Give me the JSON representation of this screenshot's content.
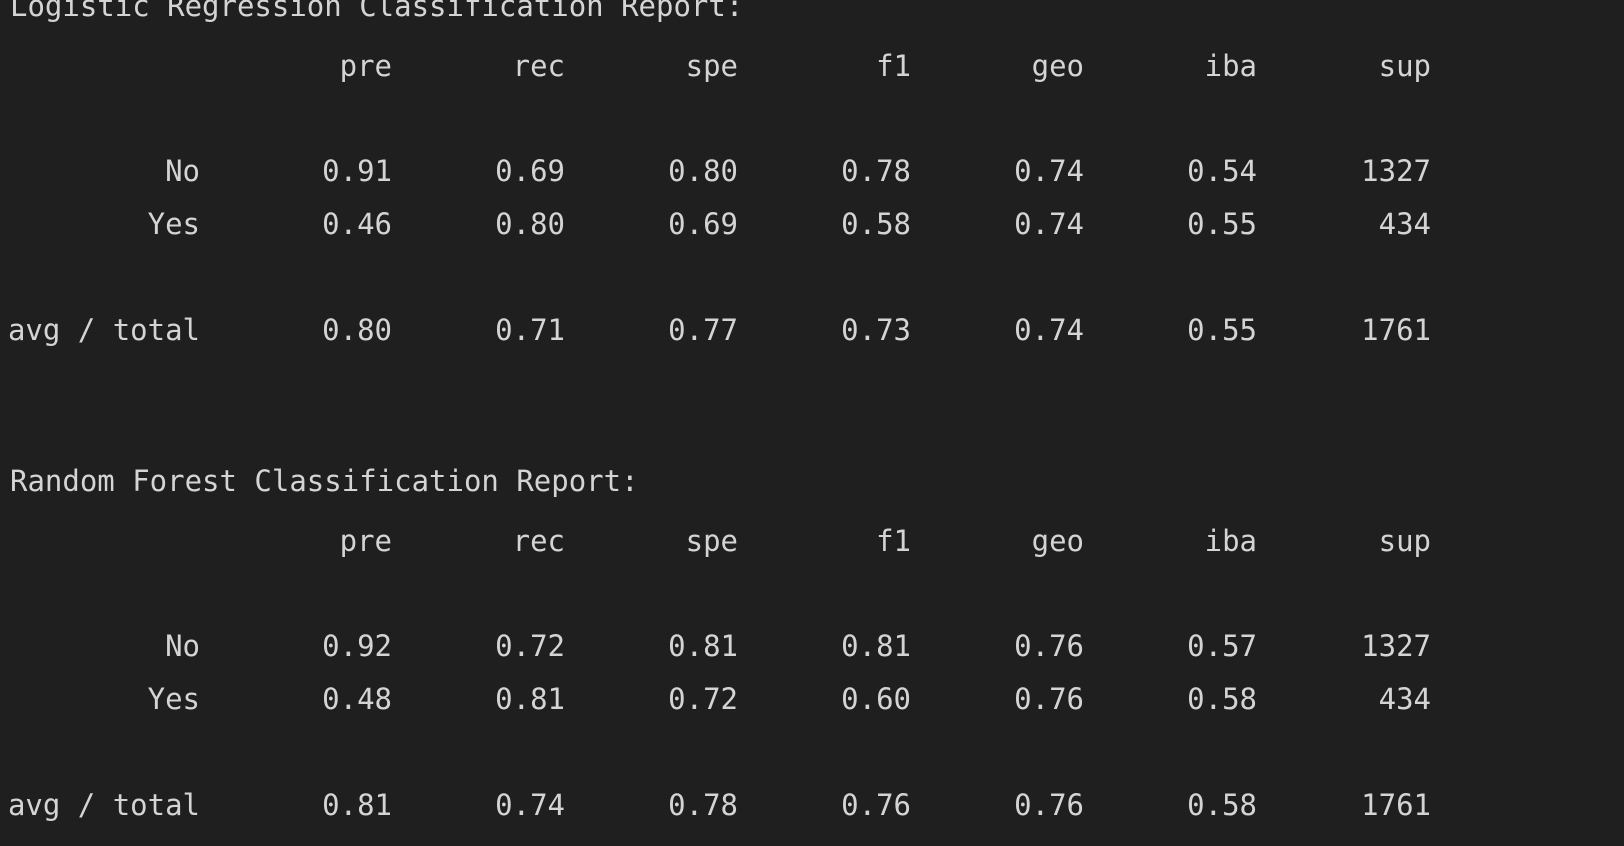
{
  "reports": [
    {
      "title": "Logistic Regression Classification Report:",
      "columns": [
        "pre",
        "rec",
        "spe",
        "f1",
        "geo",
        "iba",
        "sup"
      ],
      "rows": [
        {
          "label": "No",
          "values": [
            "0.91",
            "0.69",
            "0.80",
            "0.78",
            "0.74",
            "0.54",
            "1327"
          ]
        },
        {
          "label": "Yes",
          "values": [
            "0.46",
            "0.80",
            "0.69",
            "0.58",
            "0.74",
            "0.55",
            "434"
          ]
        },
        {
          "label": "avg / total",
          "values": [
            "0.80",
            "0.71",
            "0.77",
            "0.73",
            "0.74",
            "0.55",
            "1761"
          ]
        }
      ]
    },
    {
      "title": "Random Forest Classification Report:",
      "columns": [
        "pre",
        "rec",
        "spe",
        "f1",
        "geo",
        "iba",
        "sup"
      ],
      "rows": [
        {
          "label": "No",
          "values": [
            "0.92",
            "0.72",
            "0.81",
            "0.81",
            "0.76",
            "0.57",
            "1327"
          ]
        },
        {
          "label": "Yes",
          "values": [
            "0.48",
            "0.81",
            "0.72",
            "0.60",
            "0.76",
            "0.58",
            "434"
          ]
        },
        {
          "label": "avg / total",
          "values": [
            "0.81",
            "0.74",
            "0.78",
            "0.76",
            "0.76",
            "0.58",
            "1761"
          ]
        }
      ]
    }
  ]
}
